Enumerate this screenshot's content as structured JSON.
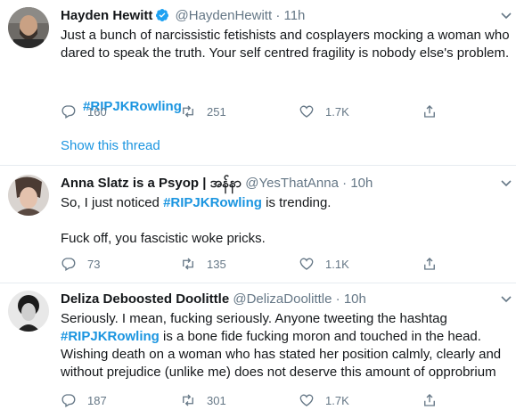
{
  "tweets": [
    {
      "name": "Hayden Hewitt",
      "verified": true,
      "handle": "@HaydenHewitt",
      "sep": "·",
      "time": "11h",
      "text": "Just a bunch of narcissistic fetishists and cosplayers mocking a woman who dared to speak the truth. Your self centred fragility is nobody else's problem.",
      "hashtag_line": "#RIPJKRowling",
      "replies": "160",
      "retweets": "251",
      "likes": "1.7K",
      "show_thread": "Show this thread"
    },
    {
      "name": "Anna Slatz is a Psyop | အန်နာ",
      "verified": false,
      "handle": "@YesThatAnna",
      "sep": "·",
      "time": "10h",
      "text_before": "So, I just noticed ",
      "hashtag": "#RIPJKRowling",
      "text_after": " is trending.",
      "text_second": "Fuck off, you fascistic woke pricks.",
      "replies": "73",
      "retweets": "135",
      "likes": "1.1K"
    },
    {
      "name": "Deliza Deboosted Doolittle",
      "verified": false,
      "handle": "@DelizaDoolittle",
      "sep": "·",
      "time": "10h",
      "text_line1": "Seriously. I mean, fucking seriously. Anyone tweeting the hashtag",
      "hashtag": "#RIPJKRowling",
      "text_after": " is a bone fide fucking moron and touched in the head.",
      "text_line3": "Wishing death on a woman who has stated her position calmly, clearly and",
      "text_line4": "without prejudice (unlike me) does not deserve this amount of opprobrium",
      "replies": "187",
      "retweets": "301",
      "likes": "1.7K"
    }
  ],
  "icons": {
    "reply": "reply-icon",
    "retweet": "retweet-icon",
    "like": "heart-icon",
    "share": "share-icon",
    "more": "chevron-down-icon",
    "verified": "verified-badge-icon"
  },
  "colors": {
    "link": "#1b95e0",
    "secondary": "#657786",
    "divider": "#e6ecf0",
    "verified": "#1da1f2"
  }
}
